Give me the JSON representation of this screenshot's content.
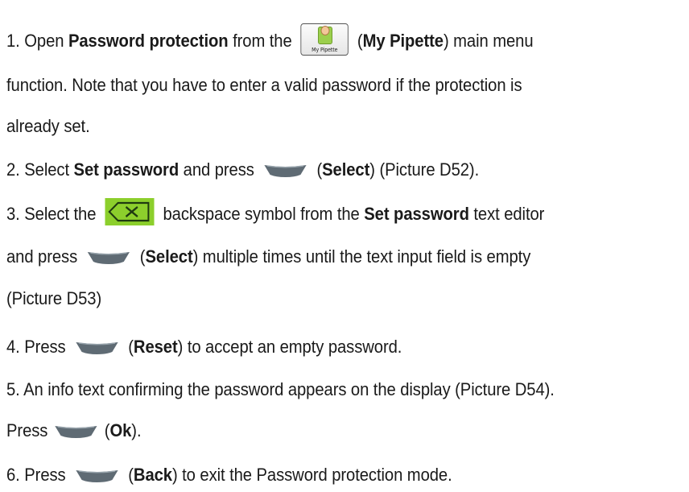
{
  "steps": [
    {
      "p1": "1. Open ",
      "b1": "Password protection",
      "p2": " from the",
      "icon_label": "My Pipette",
      "b2": "My Pipette",
      "p3": ") main menu"
    },
    {
      "p1": "function. Note that you have to enter a valid password if the protection is"
    },
    {
      "p1": "already set."
    },
    {
      "p1": "2. Select ",
      "b1": "Set password",
      "p2": " and press",
      "b2": "Select",
      "p3": ") (Picture D52)."
    },
    {
      "p1": "3. Select the",
      "p2": "backspace symbol from the ",
      "b1": "Set password",
      "p3": " text editor"
    },
    {
      "p1": "and press",
      "b1": "Select",
      "p2": ") multiple times until the text input field is empty"
    },
    {
      "p1": "(Picture D53)"
    },
    {
      "p1": "4. Press",
      "b1": "Reset",
      "p2": ") to accept an empty password."
    },
    {
      "p1": "5. An info text confirming the password appears on the display (Picture D54)."
    },
    {
      "p1": "Press",
      "b1": "Ok",
      "p2": ")."
    },
    {
      "p1": "6. Press",
      "b1": "Back",
      "p2": ") to exit the Password protection mode."
    }
  ],
  "icons": {
    "app": "my-pipette-icon",
    "softkey_right": "right-softkey-icon",
    "softkey_left": "left-softkey-icon",
    "backspace": "backspace-icon",
    "softkey_color": "#5f6b74",
    "backspace_color": "#8ccf2c"
  }
}
